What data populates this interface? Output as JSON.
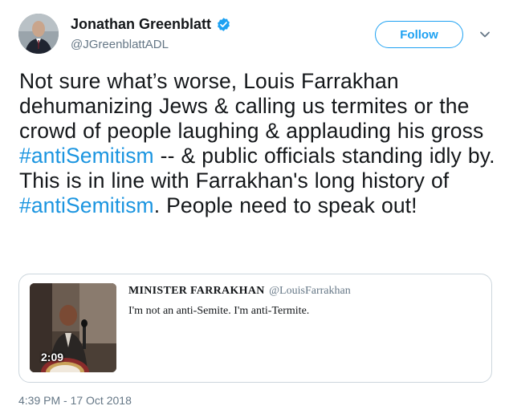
{
  "author": {
    "display_name": "Jonathan Greenblatt",
    "handle": "@JGreenblattADL",
    "avatar_icon": "profile-photo",
    "verified_icon": "verified-badge-icon"
  },
  "actions": {
    "follow_label": "Follow",
    "menu_icon": "chevron-down-icon"
  },
  "tweet": {
    "segments": [
      {
        "text": "Not sure what’s worse, Louis Farrakhan dehumanizing Jews & calling us termites or the crowd of people laughing & applauding his gross ",
        "type": "text"
      },
      {
        "text": "#antiSemitism",
        "type": "hashtag"
      },
      {
        "text": " -- & public officials standing idly by. This is in line with Farrakhan's long history of ",
        "type": "text"
      },
      {
        "text": "#antiSemitism",
        "type": "hashtag"
      },
      {
        "text": ". People need to speak out!",
        "type": "text"
      }
    ],
    "timestamp": "4:39 PM - 17 Oct 2018"
  },
  "quoted_tweet": {
    "display_name": "MINISTER FARRAKHAN",
    "handle": "@LouisFarrakhan",
    "text": "I'm not an anti-Semite. I'm anti-Termite.",
    "video_duration": "2:09"
  },
  "colors": {
    "accent": "#1da1f2",
    "hashtag": "#1b95e0",
    "secondary_text": "#657786",
    "border": "#ccd6dd"
  }
}
